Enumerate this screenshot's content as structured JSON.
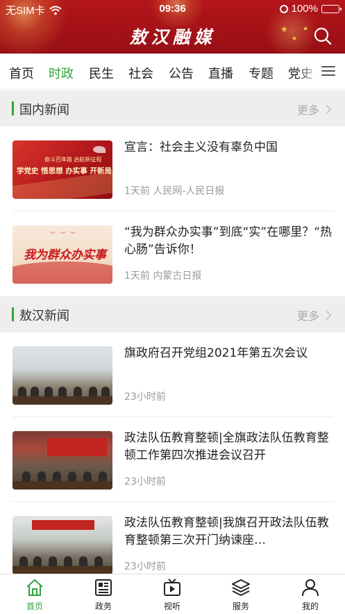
{
  "status_bar": {
    "carrier": "无SIM卡",
    "time": "09:36",
    "battery": "100%"
  },
  "header": {
    "title": "敖汉融媒",
    "search_icon": "search-icon"
  },
  "nav": {
    "tabs": [
      {
        "label": "首页",
        "active": false
      },
      {
        "label": "时政",
        "active": true
      },
      {
        "label": "民生",
        "active": false
      },
      {
        "label": "社会",
        "active": false
      },
      {
        "label": "公告",
        "active": false
      },
      {
        "label": "直播",
        "active": false
      },
      {
        "label": "专题",
        "active": false
      },
      {
        "label": "党史",
        "active": false
      }
    ],
    "menu_icon": "menu-icon"
  },
  "sections": [
    {
      "title": "国内新闻",
      "more": "更多",
      "items": [
        {
          "title": "宣言：社会主义没有辜负中国",
          "meta": "1天前 人民网-人民日报",
          "thumb_caption_small": "奋斗百年路 启航新征程",
          "thumb_caption": "学党史 悟思想 办实事 开新局"
        },
        {
          "title": "“我为群众办实事”到底“实”在哪里？“热心肠”告诉你！",
          "meta": "1天前 内蒙古日报",
          "thumb_caption": "我为群众办实事"
        }
      ]
    },
    {
      "title": "敖汉新闻",
      "more": "更多",
      "items": [
        {
          "title": "旗政府召开党组2021年第五次会议",
          "meta": "23小时前"
        },
        {
          "title": "政法队伍教育整顿|全旗政法队伍教育整顿工作第四次推进会议召开",
          "meta": "23小时前"
        },
        {
          "title": "政法队伍教育整顿|我旗召开政法队伍教育整顿第三次开门纳谏座…",
          "meta": "23小时前"
        }
      ]
    }
  ],
  "tabbar": {
    "tabs": [
      {
        "label": "首页",
        "icon": "home-icon",
        "active": true
      },
      {
        "label": "政务",
        "icon": "document-icon",
        "active": false
      },
      {
        "label": "视听",
        "icon": "video-icon",
        "active": false
      },
      {
        "label": "服务",
        "icon": "layers-icon",
        "active": false
      },
      {
        "label": "我的",
        "icon": "user-icon",
        "active": false
      }
    ]
  },
  "colors": {
    "header_red": "#a31117",
    "accent_green": "#33a33b",
    "section_bg": "#eeeeee"
  }
}
